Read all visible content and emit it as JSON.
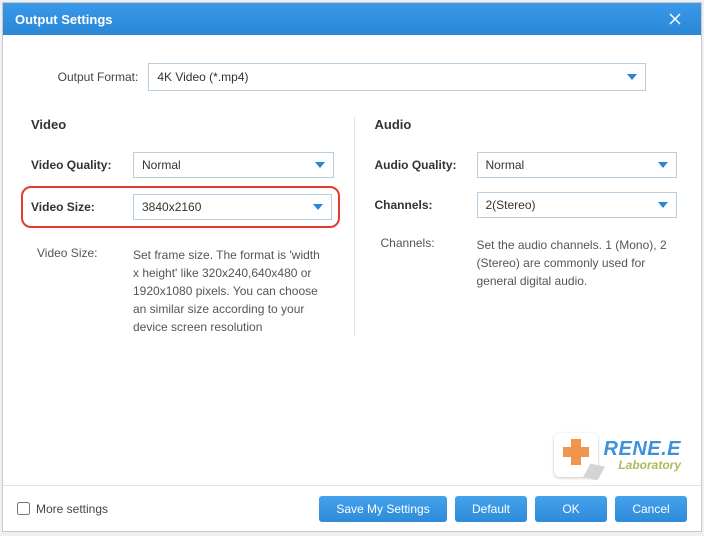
{
  "window": {
    "title": "Output Settings"
  },
  "format": {
    "label": "Output Format:",
    "value": "4K Video (*.mp4)"
  },
  "video": {
    "section_title": "Video",
    "quality_label": "Video Quality:",
    "quality_value": "Normal",
    "size_label": "Video Size:",
    "size_value": "3840x2160",
    "desc_label": "Video Size:",
    "desc_text": "Set frame size. The format is 'width x height' like 320x240,640x480 or 1920x1080 pixels. You can choose an similar size according to your device screen resolution"
  },
  "audio": {
    "section_title": "Audio",
    "quality_label": "Audio Quality:",
    "quality_value": "Normal",
    "channels_label": "Channels:",
    "channels_value": "2(Stereo)",
    "desc_label": "Channels:",
    "desc_text": "Set the audio channels. 1 (Mono), 2 (Stereo) are commonly used for general digital audio."
  },
  "logo": {
    "main": "RENE.E",
    "sub": "Laboratory"
  },
  "footer": {
    "more_label": "More settings",
    "save_btn": "Save My Settings",
    "default_btn": "Default",
    "ok_btn": "OK",
    "cancel_btn": "Cancel"
  }
}
